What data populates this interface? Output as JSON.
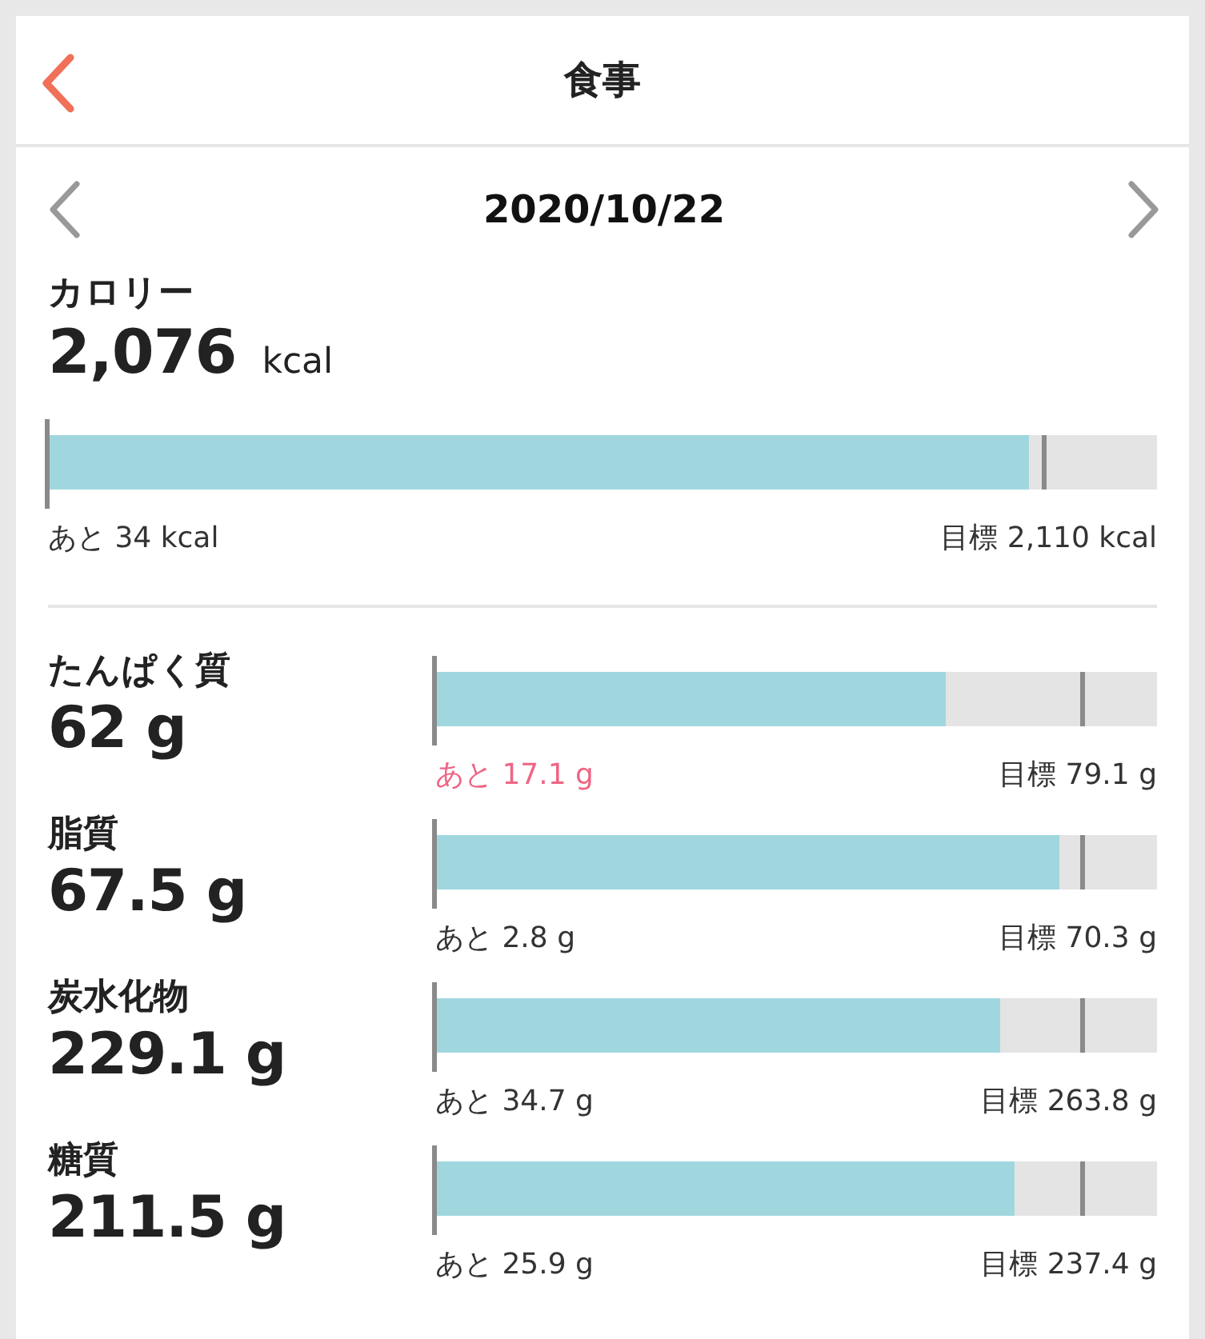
{
  "header": {
    "title": "食事"
  },
  "date_nav": {
    "date": "2020/10/22"
  },
  "calories": {
    "label": "カロリー",
    "value": "2,076",
    "unit": "kcal",
    "bar": {
      "level": 0.884,
      "goal_marker": {
        "level": 0.897
      }
    },
    "remaining": "あと 34 kcal",
    "remaining_warning": false,
    "goal": "目標 2,110 kcal"
  },
  "nutrients": [
    {
      "name": "たんぱく質",
      "value": "62 g",
      "level": 0.707,
      "goal_marker": {
        "level": 0.896
      },
      "remaining": "あと 17.1 g",
      "warning": true,
      "goal": "目標 79.1 g"
    },
    {
      "name": "脂質",
      "value": "67.5 g",
      "level": 0.864,
      "goal_marker": {
        "level": 0.896
      },
      "remaining": "あと 2.8 g",
      "warning": false,
      "goal": "目標 70.3 g"
    },
    {
      "name": "炭水化物",
      "value": "229.1 g",
      "level": 0.782,
      "goal_marker": {
        "level": 0.896
      },
      "remaining": "あと 34.7 g",
      "warning": false,
      "goal": "目標 263.8 g"
    },
    {
      "name": "糖質",
      "value": "211.5 g",
      "level": 0.802,
      "goal_marker": {
        "level": 0.896
      },
      "remaining": "あと 25.9 g",
      "warning": false,
      "goal": "目標 237.4 g"
    }
  ]
}
